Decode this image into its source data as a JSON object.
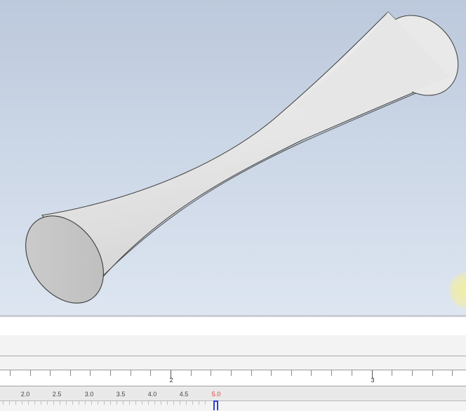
{
  "timeline": {
    "top_ruler_labels": [
      "2",
      "3"
    ],
    "bottom_ruler_labels": [
      "2.0",
      "2.5",
      "3.0",
      "3.5",
      "4.0",
      "4.5",
      "5.0"
    ],
    "current_time": "5.0"
  },
  "colors": {
    "viewport_top": "#bcc9dc",
    "viewport_bottom": "#dde6f1",
    "model_face": "#e6e6e6",
    "end_cap": "#c8c8c8",
    "current_time_label": "#e23b2e",
    "playhead": "#2a3fd4"
  }
}
